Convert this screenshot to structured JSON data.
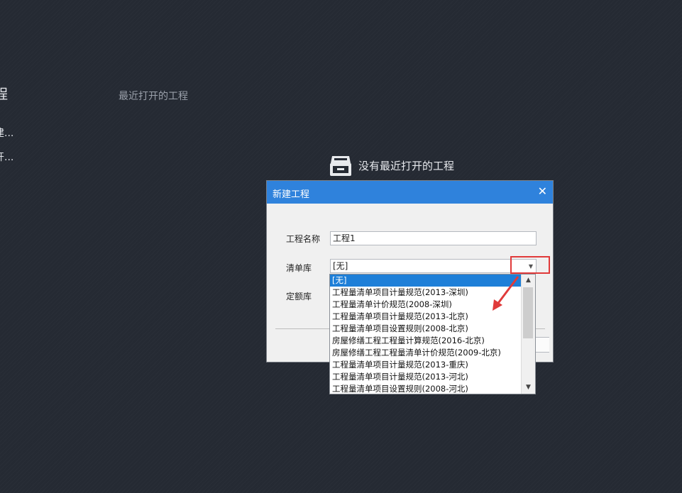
{
  "background": {
    "left_panel": {
      "title": "程",
      "items": [
        "建...",
        "开..."
      ]
    },
    "recent": {
      "heading": "最近打开的工程",
      "empty_message": "没有最近打开的工程",
      "empty_icon": "archive-box-icon"
    }
  },
  "dialog": {
    "title": "新建工程",
    "close_icon": "close-icon",
    "project_name_label": "工程名称",
    "project_name_value": "工程1",
    "bill_library_label": "清单库",
    "bill_library_value": "[无]",
    "quota_library_label": "定额库"
  },
  "dropdown": {
    "options": [
      "[无]",
      "工程量清单项目计量规范(2013-深圳)",
      "工程量清单计价规范(2008-深圳)",
      "工程量清单项目计量规范(2013-北京)",
      "工程量清单项目设置规则(2008-北京)",
      "房屋修缮工程工程量计算规范(2016-北京)",
      "房屋修缮工程工程量清单计价规范(2009-北京)",
      "工程量清单项目计量规范(2013-重庆)",
      "工程量清单项目计量规范(2013-河北)",
      "工程量清单项目设置规则(2008-河北)"
    ],
    "selected_index": 0
  },
  "annotation": {
    "color": "#e03a3a"
  },
  "colors": {
    "accent": "#2f82dc",
    "background": "#252a33",
    "selection": "#1e7fd8"
  }
}
